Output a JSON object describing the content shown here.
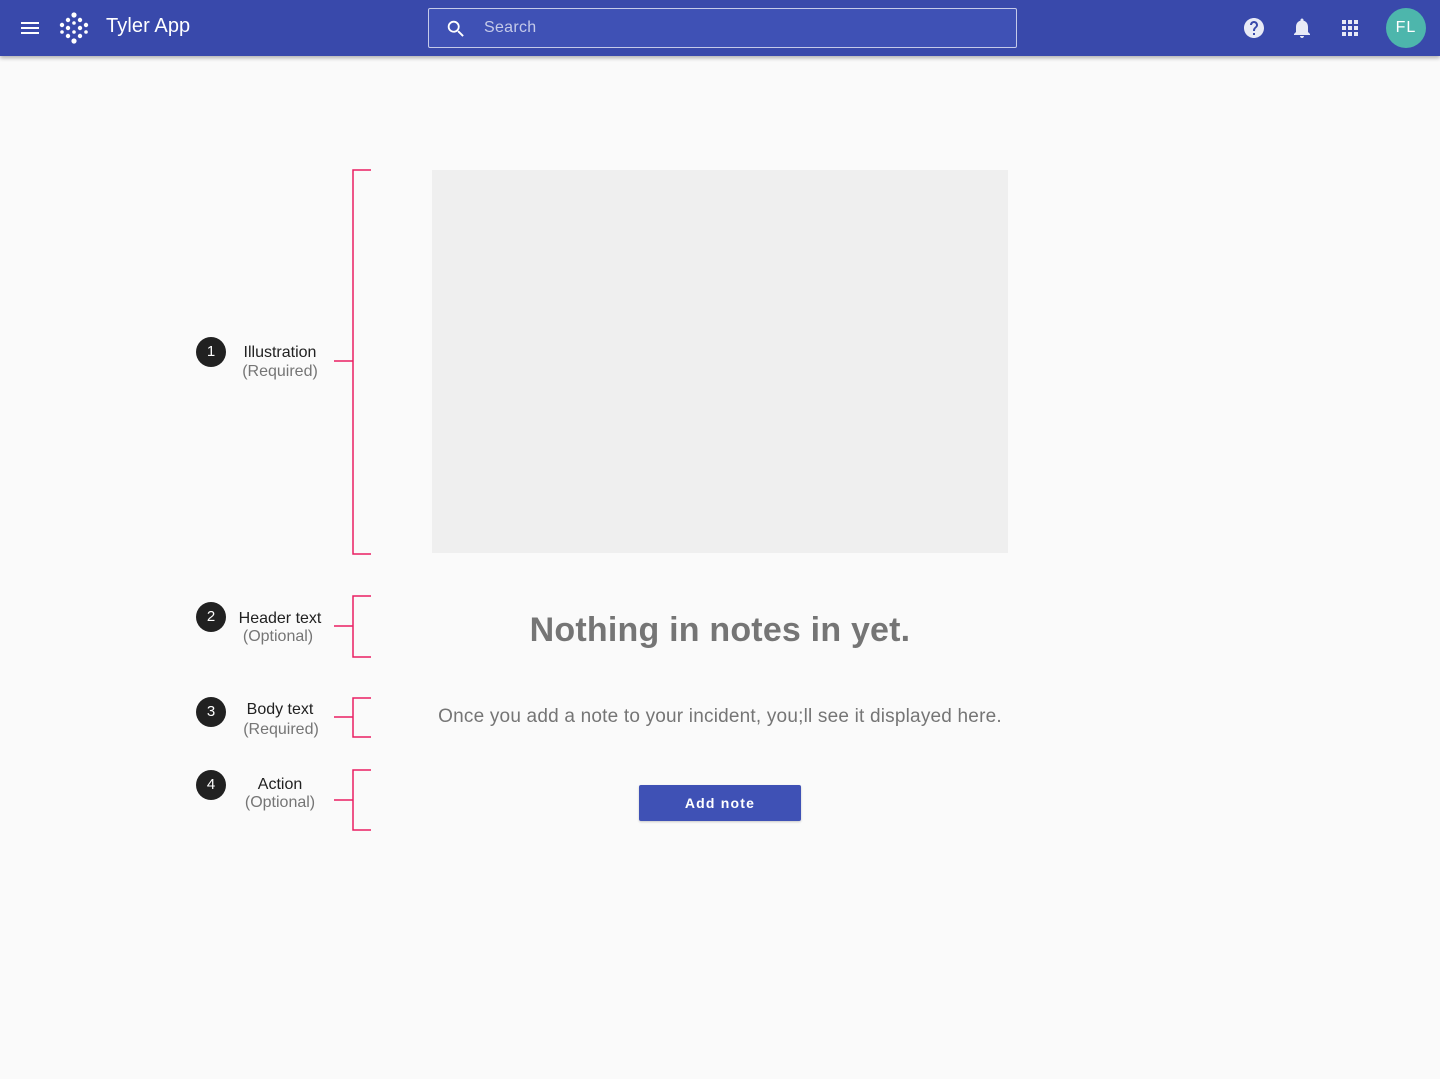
{
  "appbar": {
    "title": "Tyler App",
    "search_placeholder": "Search",
    "avatar_initials": "FL",
    "colors": {
      "bar": "#3949ab",
      "avatar": "#4db6ac"
    },
    "icons": [
      "menu-icon",
      "tyler-logo-icon",
      "search-icon",
      "help-icon",
      "notifications-bell-icon",
      "apps-grid-icon"
    ]
  },
  "empty_state": {
    "header_text": "Nothing in notes in yet.",
    "body_text": "Once you add a note to your incident, you;ll see it displayed here.",
    "action_label": "Add note",
    "action_color": "#3f51b5"
  },
  "annotations": [
    {
      "number": "1",
      "label": "Illustration",
      "sub": "(Required)"
    },
    {
      "number": "2",
      "label": "Header text",
      "sub": "(Optional)"
    },
    {
      "number": "3",
      "label": "Body text",
      "sub": "(Required)"
    },
    {
      "number": "4",
      "label": "Action",
      "sub": "(Optional)"
    }
  ],
  "annotation_color": "#e91e63"
}
